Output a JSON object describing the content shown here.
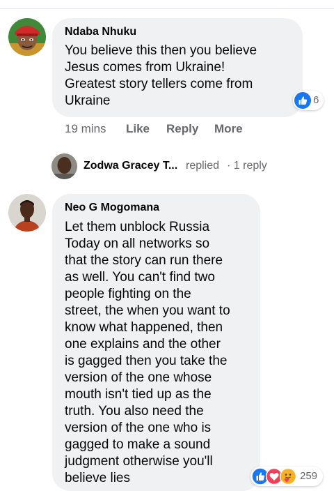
{
  "comments": [
    {
      "author": "Ndaba Nhuku",
      "lines": [
        "You believe this then you believe",
        "Jesus comes from Ukraine!",
        "Greatest story tellers come from",
        "Ukraine"
      ],
      "reaction_count": "6",
      "reaction_icons": [
        "like-icon"
      ],
      "time": "19 mins",
      "actions": [
        "Like",
        "Reply",
        "More"
      ]
    },
    {
      "author": "Neo G Mogomana",
      "lines": [
        "Let them unblock Russia",
        "Today on all networks so",
        "that the story can run there",
        "as well. You can't find two",
        "people fighting on the",
        "street, the when you want to",
        "know what happened, then",
        "one explains and the other",
        "is gagged then you take the",
        "version of the one whose",
        "mouth isn't tied up as the",
        "truth. You also need the",
        "version of the one who is",
        "gagged to make a sound",
        "judgment otherwise you'll",
        "believe lies"
      ],
      "reaction_count": "259",
      "reaction_icons": [
        "like-icon",
        "love-icon",
        "care-icon"
      ]
    }
  ],
  "reply_thread": {
    "name": "Zodwa Gracey T...",
    "verb": "replied",
    "count": "· 1 reply"
  },
  "colors": {
    "bubble": "#eff1f3",
    "meta_text": "#65676b",
    "like_blue": "#1877f2",
    "love_red": "#f33e58",
    "care_yellow": "#f7b125"
  }
}
